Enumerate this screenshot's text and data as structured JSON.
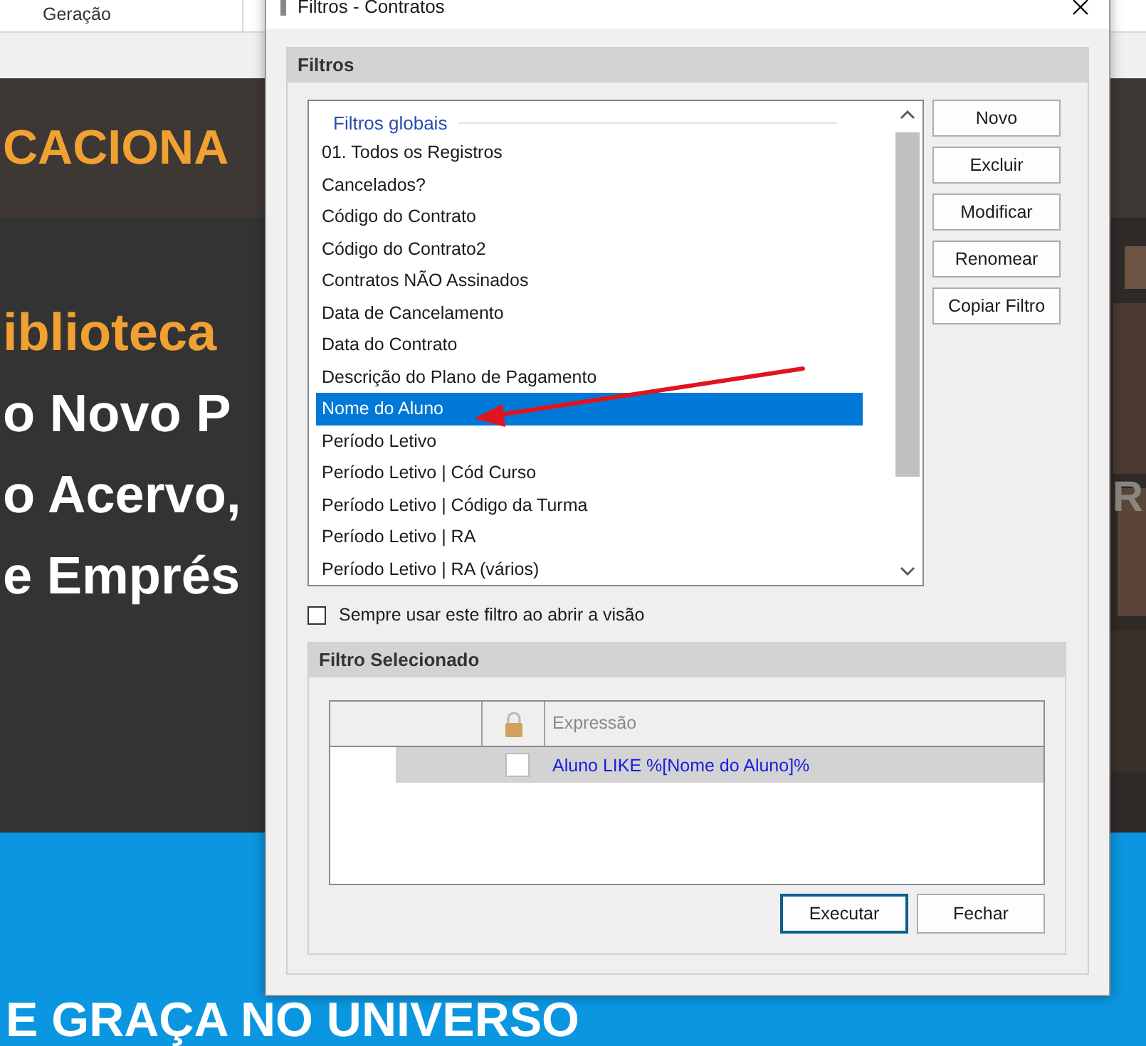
{
  "background": {
    "tab": "Geração",
    "banner": "CACIONA",
    "heading": "iblioteca",
    "lines": [
      "o Novo P",
      "o Acervo,",
      "e Emprés"
    ],
    "side_fragment": "R",
    "footer": "E GRAÇA NO UNIVERSO"
  },
  "window": {
    "title": "Filtros - Contratos"
  },
  "filters": {
    "title": "Filtros",
    "group": "Filtros globais",
    "items": [
      {
        "label": "01. Todos os Registros",
        "selected": false
      },
      {
        "label": "Cancelados?",
        "selected": false
      },
      {
        "label": "Código do Contrato",
        "selected": false
      },
      {
        "label": "Código do Contrato2",
        "selected": false
      },
      {
        "label": "Contratos NÃO Assinados",
        "selected": false
      },
      {
        "label": "Data de Cancelamento",
        "selected": false
      },
      {
        "label": "Data do Contrato",
        "selected": false
      },
      {
        "label": "Descrição do Plano de Pagamento",
        "selected": false
      },
      {
        "label": "Nome do Aluno",
        "selected": true
      },
      {
        "label": "Período Letivo",
        "selected": false
      },
      {
        "label": "Período Letivo | Cód Curso",
        "selected": false
      },
      {
        "label": "Período Letivo | Código da Turma",
        "selected": false
      },
      {
        "label": "Período Letivo | RA",
        "selected": false
      },
      {
        "label": "Período Letivo | RA (vários)",
        "selected": false
      }
    ],
    "buttons": [
      "Novo",
      "Excluir",
      "Modificar",
      "Renomear",
      "Copiar Filtro"
    ]
  },
  "always_use": {
    "label": "Sempre usar este filtro ao abrir a visão",
    "checked": false
  },
  "selected_filter": {
    "title": "Filtro Selecionado",
    "expression_header": "Expressão",
    "rows": [
      {
        "locked": false,
        "expression": "Aluno LIKE %[Nome do Aluno]%"
      }
    ]
  },
  "actions": [
    {
      "label": "Executar",
      "default": true
    },
    {
      "label": "Fechar",
      "default": false
    }
  ]
}
